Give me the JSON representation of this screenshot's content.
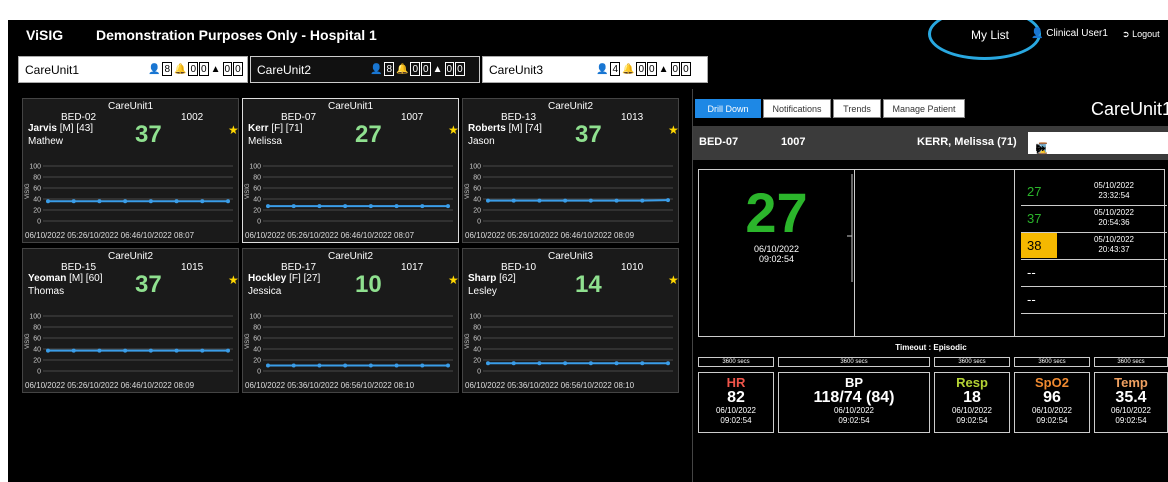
{
  "header": {
    "brand": "ViSIG",
    "title": "Demonstration Purposes Only - Hospital 1",
    "my_list": "My List",
    "user": "Clinical User1",
    "logout": "Logout"
  },
  "unit_tabs": [
    {
      "name": "CareUnit1",
      "patients": "8",
      "bells": [
        "0",
        "0"
      ],
      "alerts": [
        "0",
        "0"
      ]
    },
    {
      "name": "CareUnit2",
      "patients": "8",
      "bells": [
        "0",
        "0"
      ],
      "alerts": [
        "0",
        "0"
      ]
    },
    {
      "name": "CareUnit3",
      "patients": "4",
      "bells": [
        "0",
        "0"
      ],
      "alerts": [
        "0",
        "0"
      ]
    }
  ],
  "panels": [
    {
      "unit": "CareUnit1",
      "bed": "BED-02",
      "num": "1002",
      "surname": "Jarvis",
      "details": " [M] [43]",
      "firstname": "Mathew",
      "score": "37",
      "date": "06/10/2022 05:26/10/2022 06:46/10/2022 08:07",
      "series": [
        36,
        36,
        36,
        36,
        36,
        36,
        36,
        36
      ]
    },
    {
      "unit": "CareUnit1",
      "bed": "BED-07",
      "num": "1007",
      "surname": "Kerr",
      "details": " [F] [71]",
      "firstname": "Melissa",
      "score": "27",
      "date": "06/10/2022 05:26/10/2022 06:46/10/2022 08:07",
      "series": [
        27,
        27,
        27,
        27,
        27,
        27,
        27,
        27
      ]
    },
    {
      "unit": "CareUnit2",
      "bed": "BED-13",
      "num": "1013",
      "surname": "Roberts",
      "details": " [M] [74]",
      "firstname": "Jason",
      "score": "37",
      "date": "06/10/2022 05:26/10/2022 06:46/10/2022 08:09",
      "series": [
        37,
        37,
        37,
        37,
        37,
        37,
        37,
        38
      ]
    },
    {
      "unit": "CareUnit2",
      "bed": "BED-15",
      "num": "1015",
      "surname": "Yeoman",
      "details": " [M] [60]",
      "firstname": "Thomas",
      "score": "37",
      "date": "06/10/2022 05:26/10/2022 06:46/10/2022 08:09",
      "series": [
        37,
        37,
        37,
        37,
        37,
        37,
        37,
        37
      ]
    },
    {
      "unit": "CareUnit2",
      "bed": "BED-17",
      "num": "1017",
      "surname": "Hockley",
      "details": " [F] [27]",
      "firstname": "Jessica",
      "score": "10",
      "date": "06/10/2022 05:36/10/2022 06:56/10/2022 08:10",
      "series": [
        10,
        10,
        10,
        10,
        10,
        10,
        10,
        10
      ]
    },
    {
      "unit": "CareUnit3",
      "bed": "BED-10",
      "num": "1010",
      "surname": "Sharp",
      "details": " [62]",
      "firstname": "Lesley",
      "score": "14",
      "date": "06/10/2022 05:36/10/2022 06:56/10/2022 08:10",
      "series": [
        14,
        14,
        14,
        14,
        14,
        14,
        14,
        14
      ]
    }
  ],
  "y_ticks": [
    "100",
    "80",
    "60",
    "40",
    "20",
    "0"
  ],
  "y_label": "ViSIG",
  "drill": {
    "tabs": [
      "Drill Down",
      "Notifications",
      "Trends",
      "Manage Patient"
    ],
    "care_unit": "CareUnit1",
    "bed": "BED-07",
    "num": "1007",
    "patient": "KERR, Melissa (71)",
    "score": "27",
    "score_date": "06/10/2022",
    "score_time": "09:02:54",
    "history": [
      {
        "value": "27",
        "date": "05/10/2022",
        "time": "23:32:54",
        "color": "#2bb52b",
        "bg": "#000"
      },
      {
        "value": "37",
        "date": "05/10/2022",
        "time": "20:54:36",
        "color": "#2bb52b",
        "bg": "#000"
      },
      {
        "value": "38",
        "date": "05/10/2022",
        "time": "20:43:37",
        "color": "#000",
        "bg": "#f5b800"
      },
      {
        "value": "--",
        "date": "",
        "time": "",
        "color": "#fff",
        "bg": "#000"
      },
      {
        "value": "--",
        "date": "",
        "time": "",
        "color": "#fff",
        "bg": "#000"
      }
    ],
    "timeout": "Timeout : Episodic",
    "secs": [
      "3600 secs",
      "3600 secs",
      "3600 secs",
      "3600 secs",
      "3600 secs"
    ],
    "vitals": [
      {
        "label": "HR",
        "value": "82",
        "date": "06/10/2022",
        "time": "09:02:54",
        "color": "#f0554a"
      },
      {
        "label": "BP",
        "value": "118/74 (84)",
        "date": "06/10/2022",
        "time": "09:02:54",
        "color": "#ffffff"
      },
      {
        "label": "Resp",
        "value": "18",
        "date": "06/10/2022",
        "time": "09:02:54",
        "color": "#b5d334"
      },
      {
        "label": "SpO2",
        "value": "96",
        "date": "06/10/2022",
        "time": "09:02:54",
        "color": "#f08a30"
      },
      {
        "label": "Temp",
        "value": "35.4",
        "date": "06/10/2022",
        "time": "09:02:54",
        "color": "#f0a060"
      }
    ]
  }
}
